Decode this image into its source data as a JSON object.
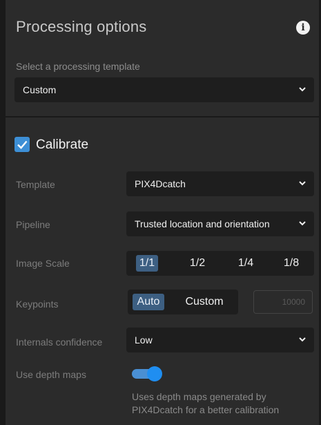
{
  "header": {
    "title": "Processing options",
    "info_icon": "info-icon",
    "template_label": "Select a processing template",
    "template_value": "Custom"
  },
  "calibrate": {
    "label": "Calibrate",
    "checked": true,
    "accent_color": "#3d8fd6"
  },
  "fields": {
    "template": {
      "label": "Template",
      "value": "PIX4Dcatch"
    },
    "pipeline": {
      "label": "Pipeline",
      "value": "Trusted location and orientation"
    },
    "image_scale": {
      "label": "Image Scale",
      "options": [
        "1/1",
        "1/2",
        "1/4",
        "1/8"
      ],
      "selected": "1/1"
    },
    "keypoints": {
      "label": "Keypoints",
      "options": [
        "Auto",
        "Custom"
      ],
      "selected": "Auto",
      "input_placeholder": "10000"
    },
    "internals_confidence": {
      "label": "Internals confidence",
      "value": "Low"
    },
    "use_depth_maps": {
      "label": "Use depth maps",
      "enabled": true,
      "description": "Uses depth maps generated by PIX4Dcatch for a better calibration"
    }
  }
}
